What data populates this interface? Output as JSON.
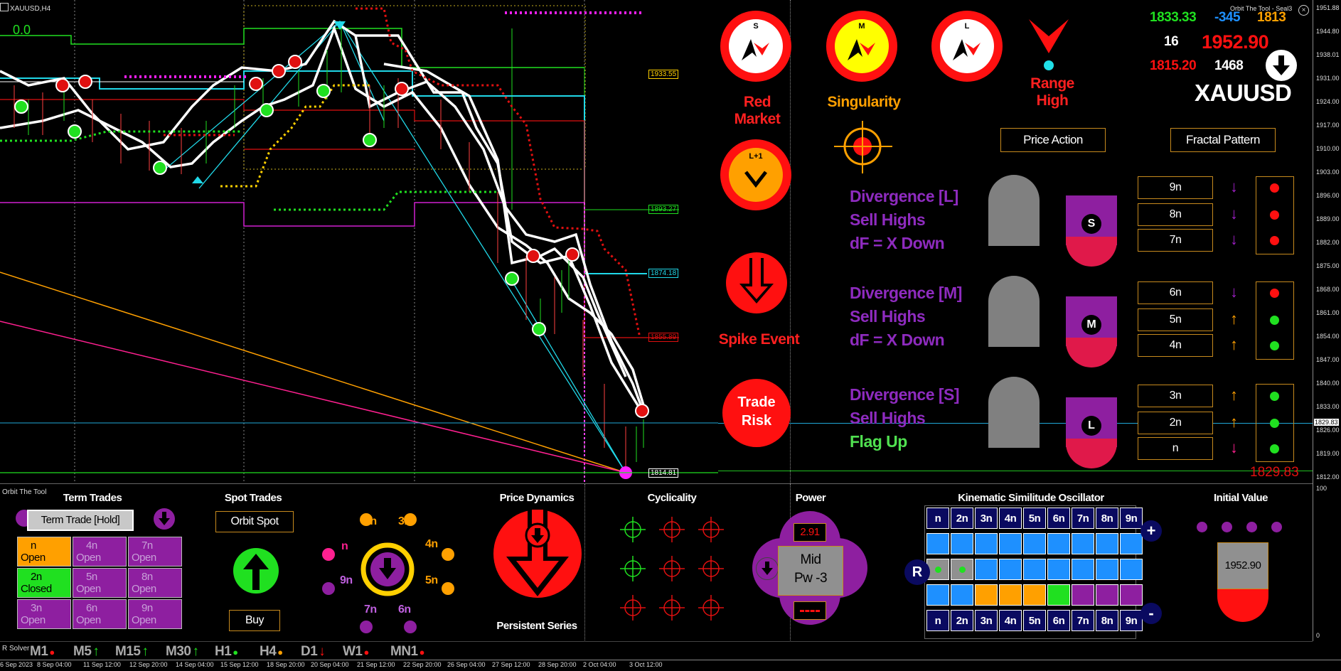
{
  "chart": {
    "symbol_title": "XAUUSD,H4",
    "indicator_title": "Orbit The Tool - Seal3",
    "zero_label": "0.0",
    "price_tags": [
      "1933.55",
      "1893.27",
      "1874.18",
      "1855.89",
      "1814.81"
    ],
    "current_price_tag": "1829.83",
    "big_price": "1829.83"
  },
  "price_axis": [
    "1951.88",
    "1944.80",
    "1938.01",
    "1931.00",
    "1924.00",
    "1917.00",
    "1910.00",
    "1903.00",
    "1896.00",
    "1889.00",
    "1882.00",
    "1875.00",
    "1868.00",
    "1861.00",
    "1854.00",
    "1847.00",
    "1840.00",
    "1833.00",
    "1826.00",
    "1819.00",
    "1812.00"
  ],
  "bottom_axis": [
    "100",
    "0"
  ],
  "time_axis": [
    "6 Sep 2023",
    "8 Sep 04:00",
    "11 Sep 12:00",
    "12 Sep 20:00",
    "14 Sep 04:00",
    "15 Sep 12:00",
    "18 Sep 20:00",
    "20 Sep 04:00",
    "21 Sep 12:00",
    "22 Sep 20:00",
    "26 Sep 04:00",
    "27 Sep 12:00",
    "28 Sep 20:00",
    "2 Oct 04:00",
    "3 Oct 12:00"
  ],
  "market_panel": {
    "s_badge": "S",
    "m_badge": "M",
    "l_badge": "L",
    "l1_badge": "L+1",
    "red_market": "Red Market",
    "singularity": "Singularity",
    "range_high": "Range High",
    "spike_event": "Spike Event",
    "trade_risk_1": "Trade",
    "trade_risk_2": "Risk",
    "price_action": "Price Action",
    "fractal_pattern": "Fractal Pattern"
  },
  "stats": {
    "v1": "1833.33",
    "v2": "-345",
    "v3": "1813",
    "v4": "16",
    "v5": "1952.90",
    "v6": "1815.20",
    "v7": "1468",
    "symbol": "XAUUSD"
  },
  "divergence": [
    {
      "title": "Divergence [L]",
      "line2": "Sell Highs",
      "line3": "dF = X Down",
      "badge": "S"
    },
    {
      "title": "Divergence [M]",
      "line2": "Sell Highs",
      "line3": "dF = X Down",
      "badge": "M"
    },
    {
      "title": "Divergence [S]",
      "line2": "Sell Highs",
      "line3": "Flag Up",
      "badge": "L"
    }
  ],
  "orders": [
    {
      "label": "9n",
      "arrow": "↓",
      "arrow_color": "#a020c8",
      "dot": "#ff1010"
    },
    {
      "label": "8n",
      "arrow": "↓",
      "arrow_color": "#a020c8",
      "dot": "#ff1010"
    },
    {
      "label": "7n",
      "arrow": "↓",
      "arrow_color": "#a020c8",
      "dot": "#ff1010"
    },
    {
      "label": "6n",
      "arrow": "↓",
      "arrow_color": "#a020c8",
      "dot": "#ff1010"
    },
    {
      "label": "5n",
      "arrow": "↑",
      "arrow_color": "#ffa000",
      "dot": "#20e020"
    },
    {
      "label": "4n",
      "arrow": "↑",
      "arrow_color": "#ffa000",
      "dot": "#20e020"
    },
    {
      "label": "3n",
      "arrow": "↑",
      "arrow_color": "#ffa000",
      "dot": "#20e020"
    },
    {
      "label": "2n",
      "arrow": "↑",
      "arrow_color": "#ffa000",
      "dot": "#20e020"
    },
    {
      "label": "n",
      "arrow": "↓",
      "arrow_color": "#ff2090",
      "dot": "#20e020"
    }
  ],
  "bottom": {
    "panel_title": "Orbit The Tool",
    "term_trades": "Term Trades",
    "term_trade_button": "Term Trade [Hold]",
    "term_cells": [
      {
        "l1": "n",
        "l2": "Open",
        "bg": "#ffa000",
        "fg": "#000"
      },
      {
        "l1": "4n",
        "l2": "Open",
        "bg": "#8e1fa0",
        "fg": "#c8a0d8"
      },
      {
        "l1": "7n",
        "l2": "Open",
        "bg": "#8e1fa0",
        "fg": "#c8a0d8"
      },
      {
        "l1": "2n",
        "l2": "Closed",
        "bg": "#20e020",
        "fg": "#000"
      },
      {
        "l1": "5n",
        "l2": "Open",
        "bg": "#8e1fa0",
        "fg": "#c8a0d8"
      },
      {
        "l1": "8n",
        "l2": "Open",
        "bg": "#8e1fa0",
        "fg": "#c8a0d8"
      },
      {
        "l1": "3n",
        "l2": "Open",
        "bg": "#8e1fa0",
        "fg": "#c8a0d8"
      },
      {
        "l1": "6n",
        "l2": "Open",
        "bg": "#8e1fa0",
        "fg": "#c8a0d8"
      },
      {
        "l1": "9n",
        "l2": "Open",
        "bg": "#8e1fa0",
        "fg": "#c8a0d8"
      }
    ],
    "spot_trades": "Spot Trades",
    "orbit_spot": "Orbit Spot",
    "buy": "Buy",
    "orbit_labels": {
      "n": "n",
      "n2": "2n",
      "n3": "3n",
      "n4": "4n",
      "n5": "5n",
      "n6": "6n",
      "n7": "7n",
      "n9": "9n"
    },
    "price_dynamics": "Price Dynamics",
    "persistent_series": "Persistent Series",
    "cyclicality": "Cyclicality",
    "power": "Power",
    "power_value": "2.91",
    "mid": "Mid",
    "pw": "Pw -3",
    "kso_title": "Kinematic Similitude Oscillator",
    "kso_labels": [
      "n",
      "2n",
      "3n",
      "4n",
      "5n",
      "6n",
      "7n",
      "8n",
      "9n"
    ],
    "kso_row3": [
      "#1e90ff",
      "#1e90ff",
      "#ffa000",
      "#ffa000",
      "#ffa000",
      "#20e020",
      "#8e1fa0",
      "#8e1fa0",
      "#8e1fa0"
    ],
    "kso_r": "R",
    "kso_plus": "+",
    "kso_minus": "-",
    "initial_value": "Initial Value",
    "initial_price": "1952.90"
  },
  "solver": "R Solver",
  "timeframes": [
    {
      "label": "M1",
      "mark": "●",
      "color": "#ff1010"
    },
    {
      "label": "M5",
      "mark": "↑",
      "color": "#20e020"
    },
    {
      "label": "M15",
      "mark": "↑",
      "color": "#20e020"
    },
    {
      "label": "M30",
      "mark": "↑",
      "color": "#20e020"
    },
    {
      "label": "H1",
      "mark": "●",
      "color": "#20e020"
    },
    {
      "label": "H4",
      "mark": "●",
      "color": "#ffa000"
    },
    {
      "label": "D1",
      "mark": "↓",
      "color": "#ff1010"
    },
    {
      "label": "W1",
      "mark": "●",
      "color": "#ff1010"
    },
    {
      "label": "MN1",
      "mark": "●",
      "color": "#ff1010"
    }
  ]
}
